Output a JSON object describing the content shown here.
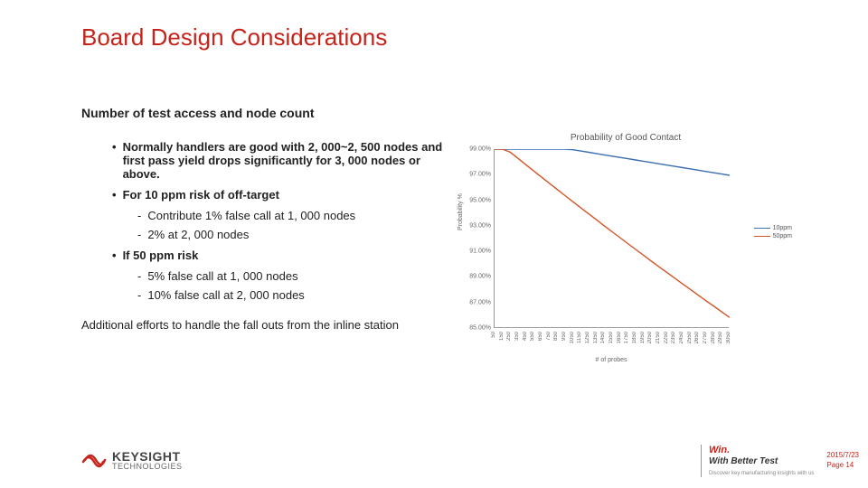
{
  "title": "Board Design Considerations",
  "subtitle": "Number of test access and node count",
  "body": {
    "b1": "Normally handlers are good with 2, 000~2, 500 nodes and first pass yield drops significantly for 3, 000 nodes or above.",
    "b2": "For 10 ppm risk of off-target",
    "b2a": "Contribute 1% false call at 1, 000 nodes",
    "b2b": "2% at 2, 000 nodes",
    "b3": "If 50 ppm risk",
    "b3a": "5% false call at 1, 000 nodes",
    "b3b": "10% false call at 2, 000 nodes",
    "tail": "Additional efforts to handle the fall outs from the inline station"
  },
  "footer": {
    "logo_name": "KEYSIGHT",
    "logo_sub": "TECHNOLOGIES",
    "tag_win": "Win.",
    "tag_line": "With Better Test",
    "tag_small": "Discover key manufacturing insights with us",
    "date": "2015/7/23",
    "page": "Page 14"
  },
  "chart_data": {
    "type": "line",
    "title": "Probability of Good Contact",
    "ylabel": "Probability %",
    "xlabel": "# of probes",
    "ylim": [
      85,
      99
    ],
    "yticks": [
      "99.00%",
      "97.00%",
      "95.00%",
      "93.00%",
      "91.00%",
      "89.00%",
      "87.00%",
      "85.00%"
    ],
    "x": [
      50,
      150,
      250,
      350,
      450,
      550,
      650,
      750,
      850,
      950,
      1050,
      1150,
      1250,
      1350,
      1450,
      1550,
      1650,
      1750,
      1850,
      1950,
      2050,
      2150,
      2250,
      2350,
      2450,
      2550,
      2650,
      2750,
      2850,
      2950,
      3050
    ],
    "series": [
      {
        "name": "10ppm",
        "color": "#3a6fb0",
        "values": [
          99.95,
          99.85,
          99.75,
          99.65,
          99.55,
          99.45,
          99.35,
          99.25,
          99.15,
          99.05,
          98.95,
          98.85,
          98.75,
          98.65,
          98.55,
          98.45,
          98.35,
          98.25,
          98.15,
          98.05,
          97.95,
          97.85,
          97.75,
          97.65,
          97.55,
          97.45,
          97.35,
          97.25,
          97.15,
          97.05,
          96.95
        ]
      },
      {
        "name": "50ppm",
        "color": "#d35426",
        "values": [
          99.75,
          99.25,
          98.76,
          98.27,
          97.78,
          97.29,
          96.8,
          96.32,
          95.84,
          95.36,
          94.88,
          94.41,
          93.94,
          93.47,
          93.0,
          92.53,
          92.07,
          91.61,
          91.15,
          90.7,
          90.24,
          89.79,
          89.34,
          88.9,
          88.45,
          88.01,
          87.57,
          87.13,
          86.7,
          86.26,
          85.83
        ]
      }
    ]
  }
}
